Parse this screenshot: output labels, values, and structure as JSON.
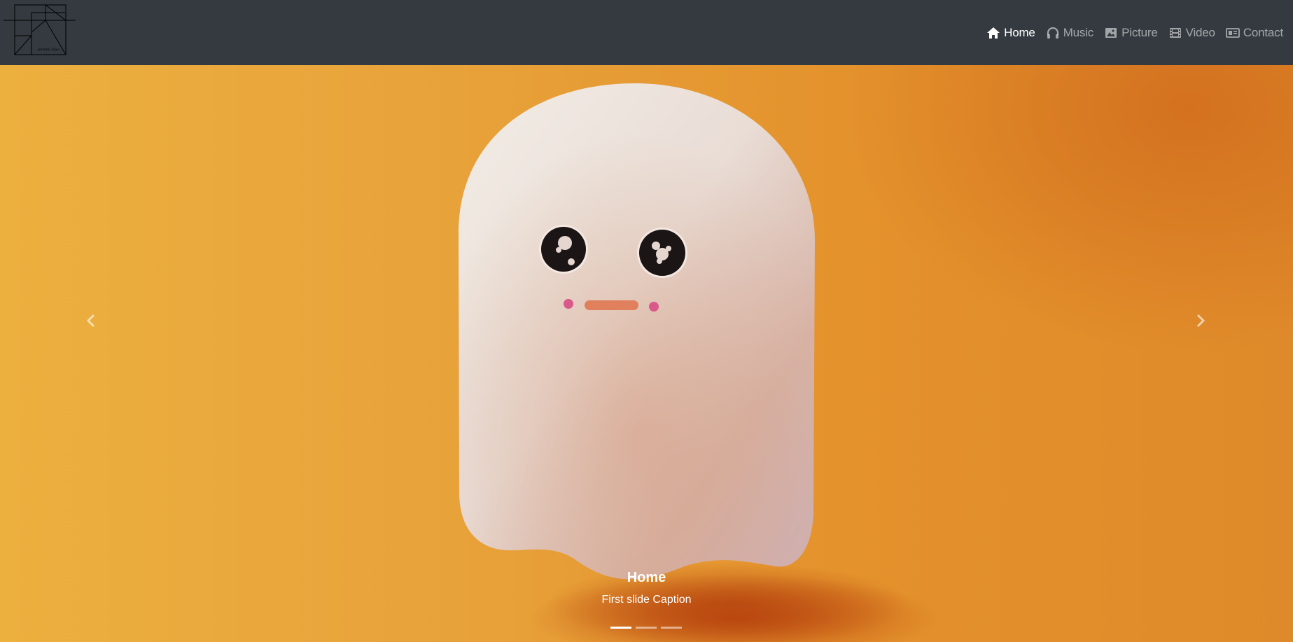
{
  "navbar": {
    "logo_text": "Jeremy Xiao",
    "links": [
      {
        "label": "Home",
        "icon": "home-icon",
        "active": true
      },
      {
        "label": "Music",
        "icon": "headphones-icon",
        "active": false
      },
      {
        "label": "Picture",
        "icon": "image-icon",
        "active": false
      },
      {
        "label": "Video",
        "icon": "film-icon",
        "active": false
      },
      {
        "label": "Contact",
        "icon": "contact-card-icon",
        "active": false
      }
    ]
  },
  "carousel": {
    "caption_title": "Home",
    "caption_text": "First slide Caption",
    "slide_count": 3,
    "active_index": 0,
    "prev_icon": "chevron-left-icon",
    "next_icon": "chevron-right-icon"
  },
  "colors": {
    "navbar_bg": "#343a40",
    "background_orange": "#e8a23a",
    "ghost_white": "#f0ebe6",
    "cheek_pink": "#d9598a"
  }
}
